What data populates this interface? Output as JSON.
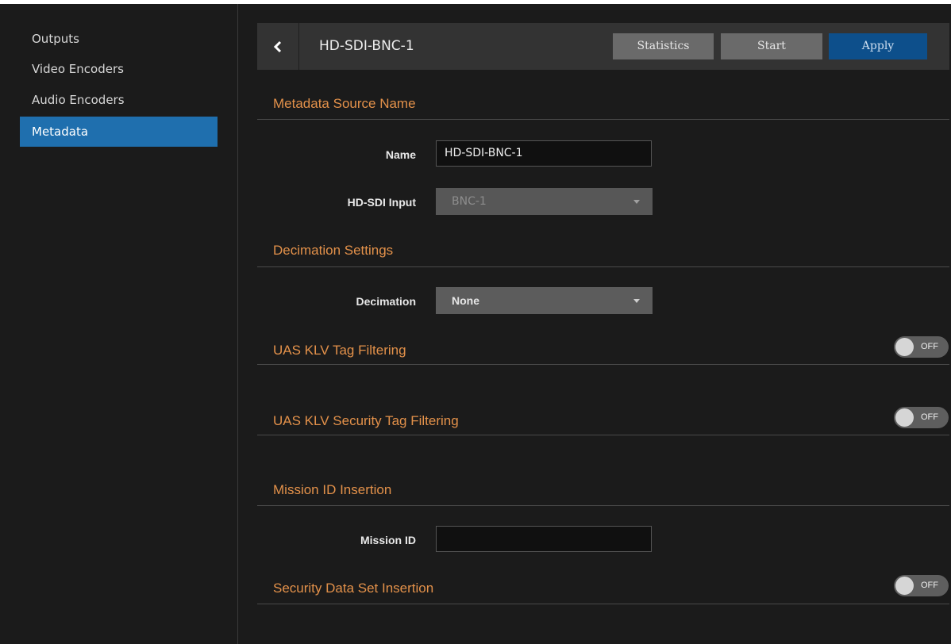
{
  "sidebar": {
    "items": [
      {
        "label": "Outputs",
        "active": false
      },
      {
        "label": "Video Encoders",
        "active": false
      },
      {
        "label": "Audio Encoders",
        "active": false
      },
      {
        "label": "Metadata",
        "active": true
      }
    ]
  },
  "header": {
    "back_icon": "chevron-left-icon",
    "title": "HD-SDI-BNC-1",
    "statistics_label": "Statistics",
    "start_label": "Start",
    "apply_label": "Apply"
  },
  "sections": {
    "source_name": {
      "title": "Metadata Source Name",
      "name_label": "Name",
      "name_value": "HD-SDI-BNC-1",
      "input_label": "HD-SDI Input",
      "input_value": "BNC-1"
    },
    "decimation": {
      "title": "Decimation Settings",
      "label": "Decimation",
      "value": "None"
    },
    "uas_klv": {
      "title": "UAS KLV Tag Filtering",
      "toggle_label": "OFF"
    },
    "uas_klv_security": {
      "title": "UAS KLV Security Tag Filtering",
      "toggle_label": "OFF"
    },
    "mission": {
      "title": "Mission ID Insertion",
      "label": "Mission ID",
      "value": ""
    },
    "security_data_set": {
      "title": "Security Data Set Insertion",
      "toggle_label": "OFF"
    }
  },
  "colors": {
    "accent": "#e3914a",
    "active_nav": "#1f6fae",
    "apply_button": "#0d4f8b",
    "background": "#1b1b1b"
  }
}
